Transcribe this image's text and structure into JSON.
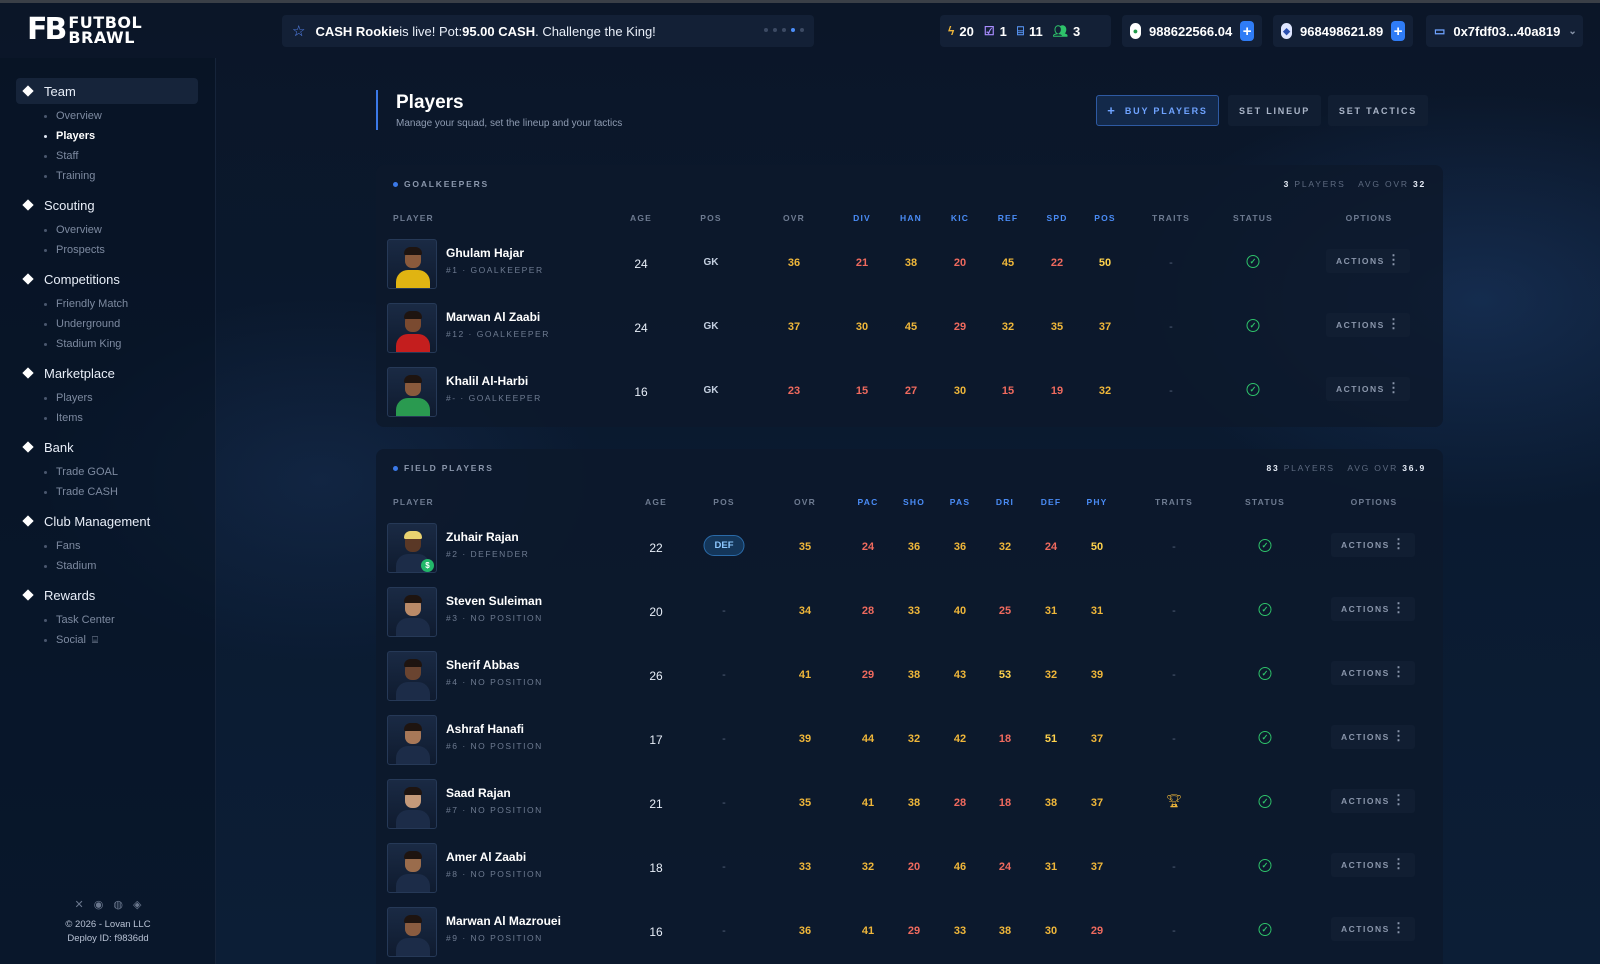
{
  "brand": {
    "mark": "FB",
    "line1": "FUTBOL",
    "line2": "BRAWL"
  },
  "ticker": {
    "title": "CASH Rookie",
    "text": " is live! Pot: ",
    "pot": "95.00 CASH",
    "cta": ". Challenge the King!"
  },
  "stats": {
    "energy": "20",
    "tasks": "1",
    "gifts": "11",
    "friends": "3"
  },
  "wallet1": "988622566.04",
  "wallet2": "968498621.89",
  "address": "0x7fdf03...40a819",
  "nav": {
    "team": "Team",
    "team_overview": "Overview",
    "team_players": "Players",
    "team_staff": "Staff",
    "team_training": "Training",
    "scouting": "Scouting",
    "scouting_overview": "Overview",
    "scouting_prospects": "Prospects",
    "competitions": "Competitions",
    "friendly": "Friendly Match",
    "underground": "Underground",
    "stadium_king": "Stadium King",
    "marketplace": "Marketplace",
    "mk_players": "Players",
    "mk_items": "Items",
    "bank": "Bank",
    "trade_goal": "Trade GOAL",
    "trade_cash": "Trade CASH",
    "club": "Club Management",
    "fans": "Fans",
    "stadium": "Stadium",
    "rewards": "Rewards",
    "task_center": "Task Center",
    "social": "Social"
  },
  "footer": {
    "copy": "© 2026 - Lovan LLC",
    "deploy": "Deploy ID: f9836dd"
  },
  "page": {
    "title": "Players",
    "subtitle": "Manage your squad, set the lineup and your tactics",
    "buy": "BUY PLAYERS",
    "lineup": "SET LINEUP",
    "tactics": "SET TACTICS"
  },
  "goalkeepers": {
    "heading": "GOALKEEPERS",
    "count": "3",
    "count_label": "PLAYERS",
    "avg_label": "AVG OVR",
    "avg": "32",
    "cols": [
      "PLAYER",
      "AGE",
      "POS",
      "OVR",
      "DIV",
      "HAN",
      "KIC",
      "REF",
      "SPD",
      "POS",
      "TRAITS",
      "STATUS",
      "OPTIONS"
    ],
    "rows": [
      {
        "name": "Ghulam Hajar",
        "info": "#1 · GOALKEEPER",
        "age": "24",
        "pos": "GK",
        "ovr": "36",
        "s1": "21",
        "s2": "38",
        "s3": "20",
        "s4": "45",
        "s5": "22",
        "s6": "50",
        "traits": "-",
        "actions": "ACTIONS"
      },
      {
        "name": "Marwan Al Zaabi",
        "info": "#12 · GOALKEEPER",
        "age": "24",
        "pos": "GK",
        "ovr": "37",
        "s1": "30",
        "s2": "45",
        "s3": "29",
        "s4": "32",
        "s5": "35",
        "s6": "37",
        "traits": "-",
        "actions": "ACTIONS"
      },
      {
        "name": "Khalil Al-Harbi",
        "info": "#- · GOALKEEPER",
        "age": "16",
        "pos": "GK",
        "ovr": "23",
        "s1": "15",
        "s2": "27",
        "s3": "30",
        "s4": "15",
        "s5": "19",
        "s6": "32",
        "traits": "-",
        "actions": "ACTIONS"
      }
    ]
  },
  "field": {
    "heading": "FIELD PLAYERS",
    "count": "83",
    "count_label": "PLAYERS",
    "avg_label": "AVG OVR",
    "avg": "36.9",
    "cols": [
      "PLAYER",
      "AGE",
      "POS",
      "OVR",
      "PAC",
      "SHO",
      "PAS",
      "DRI",
      "DEF",
      "PHY",
      "TRAITS",
      "STATUS",
      "OPTIONS"
    ],
    "rows": [
      {
        "name": "Zuhair Rajan",
        "info": "#2 · DEFENDER",
        "age": "22",
        "pos": "DEF",
        "ovr": "35",
        "s1": "24",
        "s2": "36",
        "s3": "36",
        "s4": "32",
        "s5": "24",
        "s6": "50",
        "traits": "-",
        "actions": "ACTIONS"
      },
      {
        "name": "Steven Suleiman",
        "info": "#3 · NO POSITION",
        "age": "20",
        "pos": "-",
        "ovr": "34",
        "s1": "28",
        "s2": "33",
        "s3": "40",
        "s4": "25",
        "s5": "31",
        "s6": "31",
        "traits": "-",
        "actions": "ACTIONS"
      },
      {
        "name": "Sherif Abbas",
        "info": "#4 · NO POSITION",
        "age": "26",
        "pos": "-",
        "ovr": "41",
        "s1": "29",
        "s2": "38",
        "s3": "43",
        "s4": "53",
        "s5": "32",
        "s6": "39",
        "traits": "-",
        "actions": "ACTIONS"
      },
      {
        "name": "Ashraf Hanafi",
        "info": "#6 · NO POSITION",
        "age": "17",
        "pos": "-",
        "ovr": "39",
        "s1": "44",
        "s2": "32",
        "s3": "42",
        "s4": "18",
        "s5": "51",
        "s6": "37",
        "traits": "-",
        "actions": "ACTIONS"
      },
      {
        "name": "Saad Rajan",
        "info": "#7 · NO POSITION",
        "age": "21",
        "pos": "-",
        "ovr": "35",
        "s1": "41",
        "s2": "38",
        "s3": "28",
        "s4": "18",
        "s5": "38",
        "s6": "37",
        "traits": "",
        "actions": "ACTIONS"
      },
      {
        "name": "Amer Al Zaabi",
        "info": "#8 · NO POSITION",
        "age": "18",
        "pos": "-",
        "ovr": "33",
        "s1": "32",
        "s2": "20",
        "s3": "46",
        "s4": "24",
        "s5": "31",
        "s6": "37",
        "traits": "-",
        "actions": "ACTIONS"
      },
      {
        "name": "Marwan Al Mazrouei",
        "info": "#9 · NO POSITION",
        "age": "16",
        "pos": "-",
        "ovr": "36",
        "s1": "41",
        "s2": "29",
        "s3": "33",
        "s4": "38",
        "s5": "30",
        "s6": "29",
        "traits": "-",
        "actions": "ACTIONS"
      }
    ]
  },
  "colors": {
    "accent": "#3b79e8",
    "good": "#2ec26a",
    "mid": "#f0b73a",
    "low": "#f06a5e",
    "high": "#ffd34d"
  }
}
